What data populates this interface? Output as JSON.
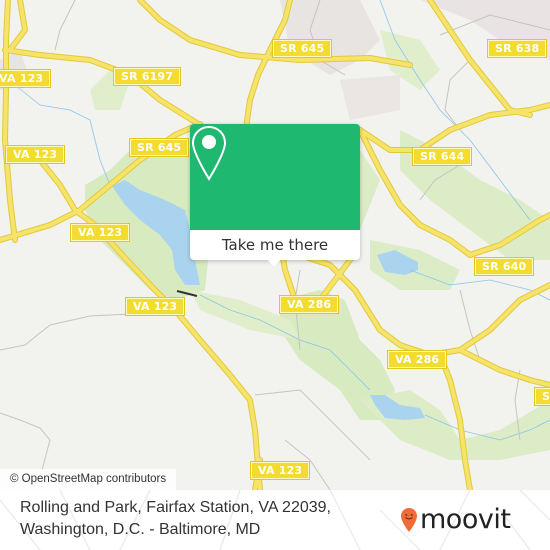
{
  "map": {
    "colors": {
      "background": "#f2f2ef",
      "park": "#d8eac0",
      "water": "#a9d3ee",
      "road_major": "#f6e36a",
      "road_casing": "#e8cf3a",
      "road_minor": "#bcbcbc",
      "stream": "#8cc4e8",
      "urban": "#e8e4e2"
    },
    "shields": [
      {
        "id": "va123-topleft",
        "label": "VA 123"
      },
      {
        "id": "sr6197",
        "label": "SR 6197"
      },
      {
        "id": "sr645-top",
        "label": "SR 645"
      },
      {
        "id": "sr638",
        "label": "SR 638"
      },
      {
        "id": "sr645-left",
        "label": "SR 645"
      },
      {
        "id": "sr644",
        "label": "SR 644"
      },
      {
        "id": "va123-left",
        "label": "VA 123"
      },
      {
        "id": "va123-mid",
        "label": "VA 123"
      },
      {
        "id": "sr640",
        "label": "SR 640"
      },
      {
        "id": "va123-lower",
        "label": "VA 123"
      },
      {
        "id": "va286-upper",
        "label": "VA 286"
      },
      {
        "id": "va286-lower",
        "label": "VA 286"
      },
      {
        "id": "sr-right-cut",
        "label": "SR"
      },
      {
        "id": "va123-bottom",
        "label": "VA 123"
      }
    ],
    "attribution": "© OpenStreetMap contributors"
  },
  "popup": {
    "button_label": "Take me there",
    "pin_icon": "map-pin-icon",
    "accent": "#1fb870"
  },
  "footer": {
    "address_line1": "Rolling and Park, Fairfax Station, VA 22039,",
    "address_line2": "Washington, D.C. - Baltimore, MD",
    "logo_text": "moovit",
    "logo_color": "#f26a38"
  }
}
